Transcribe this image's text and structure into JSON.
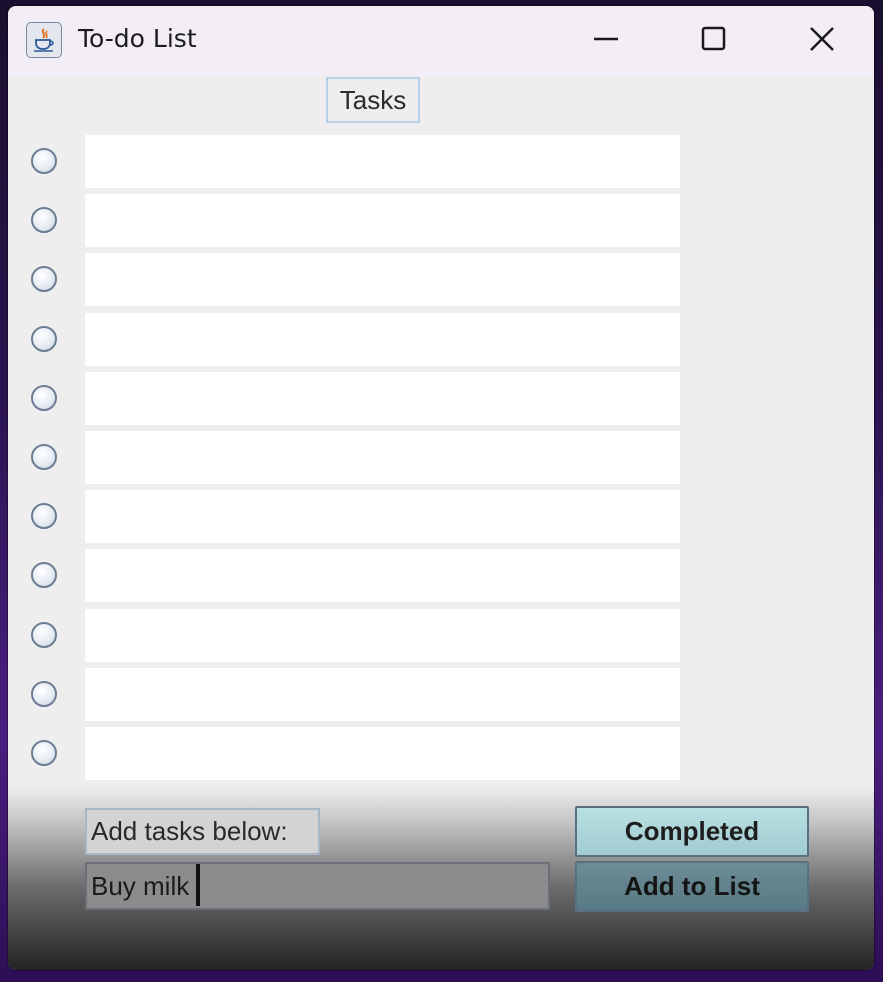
{
  "window": {
    "title": "To-do List",
    "app_icon": "java-cup-icon",
    "controls": [
      "minimize-icon",
      "maximize-icon",
      "close-icon"
    ]
  },
  "tasks_header": "Tasks",
  "task_rows": [
    {
      "value": "",
      "completed": false
    },
    {
      "value": "",
      "completed": false
    },
    {
      "value": "",
      "completed": false
    },
    {
      "value": "",
      "completed": false
    },
    {
      "value": "",
      "completed": false
    },
    {
      "value": "",
      "completed": false
    },
    {
      "value": "",
      "completed": false
    },
    {
      "value": "",
      "completed": false
    },
    {
      "value": "",
      "completed": false
    },
    {
      "value": "",
      "completed": false
    },
    {
      "value": "",
      "completed": false
    }
  ],
  "add_section": {
    "label": "Add tasks below:",
    "input_value": "Buy milk"
  },
  "buttons": {
    "completed": "Completed",
    "add_to_list": "Add to List"
  },
  "colors": {
    "window_bg": "#eeeeee",
    "title_bar": "#f3eef5",
    "completed_button": "#b9e0e2",
    "desktop_accent": "#4a1f80"
  }
}
